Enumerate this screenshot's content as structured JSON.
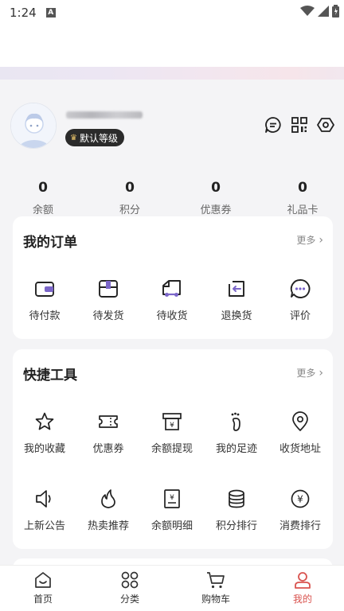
{
  "status": {
    "time": "1:24",
    "notif_letter": "A"
  },
  "profile": {
    "level_badge": "默认等级",
    "icons": [
      "message-icon",
      "qrcode-icon",
      "settings-icon"
    ]
  },
  "stats": [
    {
      "value": "0",
      "label": "余额"
    },
    {
      "value": "0",
      "label": "积分"
    },
    {
      "value": "0",
      "label": "优惠券"
    },
    {
      "value": "0",
      "label": "礼品卡"
    }
  ],
  "orders": {
    "title": "我的订单",
    "more": "更多",
    "items": [
      {
        "label": "待付款",
        "icon": "wallet-icon"
      },
      {
        "label": "待发货",
        "icon": "package-icon"
      },
      {
        "label": "待收货",
        "icon": "truck-icon"
      },
      {
        "label": "退换货",
        "icon": "return-icon"
      },
      {
        "label": "评价",
        "icon": "comment-icon"
      }
    ]
  },
  "tools": {
    "title": "快捷工具",
    "more": "更多",
    "items": [
      {
        "label": "我的收藏",
        "icon": "star-icon"
      },
      {
        "label": "优惠券",
        "icon": "ticket-icon"
      },
      {
        "label": "余额提现",
        "icon": "withdraw-icon"
      },
      {
        "label": "我的足迹",
        "icon": "footprint-icon"
      },
      {
        "label": "收货地址",
        "icon": "location-icon"
      },
      {
        "label": "上新公告",
        "icon": "speaker-icon"
      },
      {
        "label": "热卖推荐",
        "icon": "flame-icon"
      },
      {
        "label": "余额明细",
        "icon": "bill-icon"
      },
      {
        "label": "积分排行",
        "icon": "coins-icon"
      },
      {
        "label": "消费排行",
        "icon": "yen-circle-icon"
      }
    ]
  },
  "tabbar": [
    {
      "label": "首页",
      "icon": "home-icon"
    },
    {
      "label": "分类",
      "icon": "category-icon"
    },
    {
      "label": "购物车",
      "icon": "cart-icon"
    },
    {
      "label": "我的",
      "icon": "user-icon",
      "active": true
    }
  ],
  "colors": {
    "accent": "#d9534f",
    "background": "#f4f4f6",
    "badge": "#2b2b2b"
  }
}
